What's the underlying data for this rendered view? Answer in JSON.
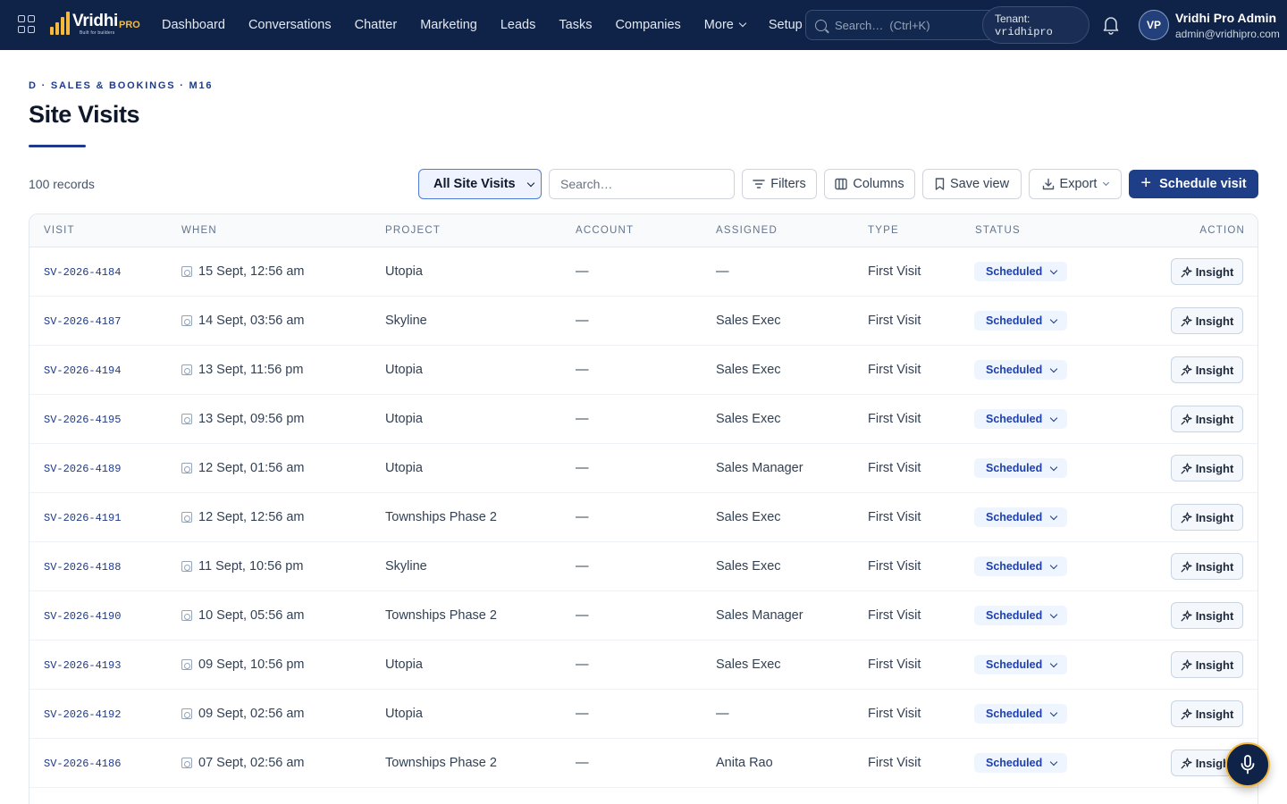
{
  "app": {
    "brand": "Vridhi",
    "brand_suffix": "PRO",
    "brand_tagline": "Built for builders"
  },
  "nav": {
    "items": [
      {
        "label": "Dashboard"
      },
      {
        "label": "Conversations"
      },
      {
        "label": "Chatter"
      },
      {
        "label": "Marketing"
      },
      {
        "label": "Leads"
      },
      {
        "label": "Tasks"
      },
      {
        "label": "Companies"
      },
      {
        "label": "More"
      },
      {
        "label": "Setup"
      }
    ],
    "search_placeholder": "Search…  (Ctrl+K)",
    "tenant_label": "Tenant:",
    "tenant_value": "vridhipro",
    "user_initials": "VP",
    "user_name": "Vridhi Pro Admin",
    "user_email": "admin@vridhipro.com"
  },
  "page": {
    "breadcrumb": "D · SALES & BOOKINGS · M16",
    "title": "Site Visits",
    "record_count": "100 records"
  },
  "toolbar": {
    "view_selected": "All Site Visits",
    "search_placeholder": "Search…",
    "filters_label": "Filters",
    "columns_label": "Columns",
    "save_view_label": "Save view",
    "export_label": "Export",
    "primary_label": "Schedule visit"
  },
  "table": {
    "columns": {
      "visit": "VISIT",
      "when": "WHEN",
      "project": "PROJECT",
      "account": "ACCOUNT",
      "assigned": "ASSIGNED",
      "type": "TYPE",
      "status": "STATUS",
      "action": "ACTION"
    },
    "action_label": "Insight",
    "rows": [
      {
        "id": "SV-2026-4184",
        "when": "15 Sept, 12:56 am",
        "project": "Utopia",
        "account": "—",
        "assigned": "—",
        "type": "First Visit",
        "status": "Scheduled"
      },
      {
        "id": "SV-2026-4187",
        "when": "14 Sept, 03:56 am",
        "project": "Skyline",
        "account": "—",
        "assigned": "Sales Exec",
        "type": "First Visit",
        "status": "Scheduled"
      },
      {
        "id": "SV-2026-4194",
        "when": "13 Sept, 11:56 pm",
        "project": "Utopia",
        "account": "—",
        "assigned": "Sales Exec",
        "type": "First Visit",
        "status": "Scheduled"
      },
      {
        "id": "SV-2026-4195",
        "when": "13 Sept, 09:56 pm",
        "project": "Utopia",
        "account": "—",
        "assigned": "Sales Exec",
        "type": "First Visit",
        "status": "Scheduled"
      },
      {
        "id": "SV-2026-4189",
        "when": "12 Sept, 01:56 am",
        "project": "Utopia",
        "account": "—",
        "assigned": "Sales Manager",
        "type": "First Visit",
        "status": "Scheduled"
      },
      {
        "id": "SV-2026-4191",
        "when": "12 Sept, 12:56 am",
        "project": "Townships Phase 2",
        "account": "—",
        "assigned": "Sales Exec",
        "type": "First Visit",
        "status": "Scheduled"
      },
      {
        "id": "SV-2026-4188",
        "when": "11 Sept, 10:56 pm",
        "project": "Skyline",
        "account": "—",
        "assigned": "Sales Exec",
        "type": "First Visit",
        "status": "Scheduled"
      },
      {
        "id": "SV-2026-4190",
        "when": "10 Sept, 05:56 am",
        "project": "Townships Phase 2",
        "account": "—",
        "assigned": "Sales Manager",
        "type": "First Visit",
        "status": "Scheduled"
      },
      {
        "id": "SV-2026-4193",
        "when": "09 Sept, 10:56 pm",
        "project": "Utopia",
        "account": "—",
        "assigned": "Sales Exec",
        "type": "First Visit",
        "status": "Scheduled"
      },
      {
        "id": "SV-2026-4192",
        "when": "09 Sept, 02:56 am",
        "project": "Utopia",
        "account": "—",
        "assigned": "—",
        "type": "First Visit",
        "status": "Scheduled"
      },
      {
        "id": "SV-2026-4186",
        "when": "07 Sept, 02:56 am",
        "project": "Townships Phase 2",
        "account": "—",
        "assigned": "Anita Rao",
        "type": "First Visit",
        "status": "Scheduled"
      }
    ]
  },
  "colors": {
    "nav_bg": "#0f2247",
    "accent": "#1e3f87",
    "brand_gold": "#f6b93b",
    "status_text": "#1e40af"
  },
  "icons": {
    "apps": "grid-icon",
    "search": "search-icon",
    "bell": "bell-icon",
    "calendar": "calendar-icon",
    "insight": "sparkle-icon",
    "mic": "microphone-icon"
  }
}
